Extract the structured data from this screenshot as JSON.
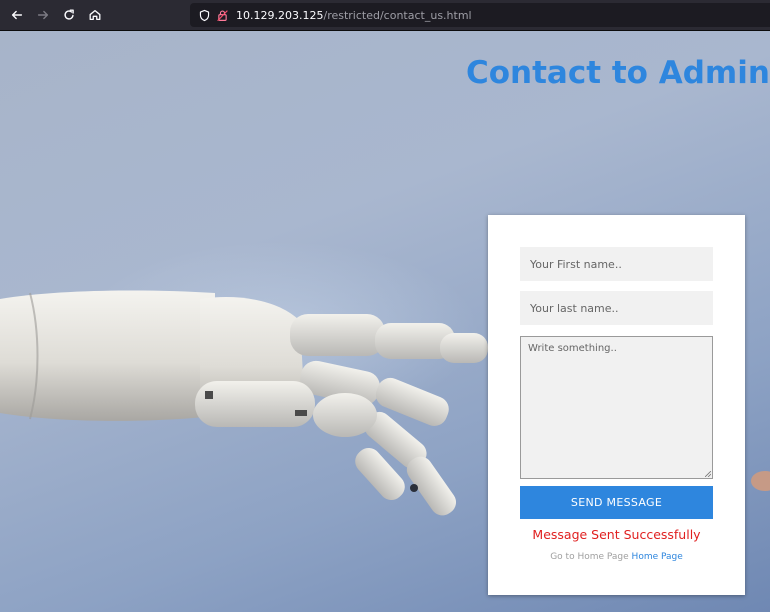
{
  "browser": {
    "url_host": "10.129.203.125",
    "url_path": "/restricted/contact_us.html",
    "icons": [
      "back-arrow-icon",
      "forward-arrow-icon",
      "reload-icon",
      "home-icon",
      "shield-icon",
      "insecure-lock-icon"
    ]
  },
  "page": {
    "title": "Contact to Admin",
    "form": {
      "first_name_placeholder": "Your First name..",
      "last_name_placeholder": "Your last name..",
      "message_placeholder": "Write something..",
      "send_label": "SEND MESSAGE"
    },
    "status_message": "Message Sent Successfully",
    "home_prompt": "Go to Home Page",
    "home_link_label": "Home Page"
  },
  "colors": {
    "accent": "#2e86de",
    "success_text": "#e02020"
  }
}
